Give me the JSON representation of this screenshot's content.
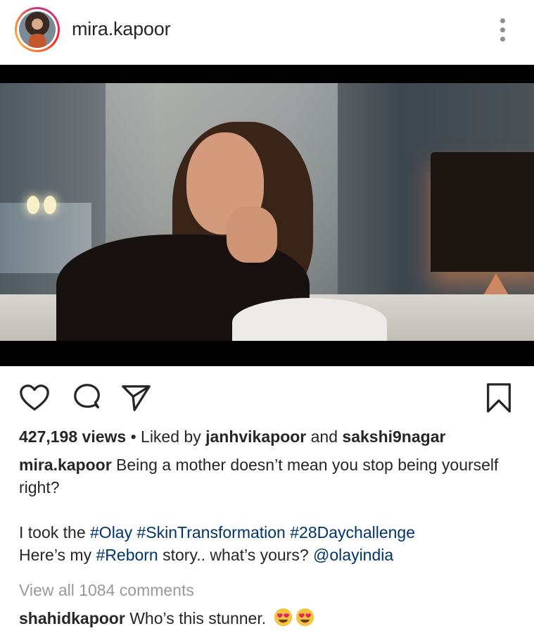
{
  "header": {
    "username": "mira.kapoor",
    "avatar": "profile-photo",
    "more_icon": "more-vertical-icon"
  },
  "media": {
    "type": "video-still",
    "description_icon": "video-frame"
  },
  "actions": {
    "like_icon": "heart-icon",
    "comment_icon": "comment-icon",
    "share_icon": "send-icon",
    "save_icon": "bookmark-icon"
  },
  "stats": {
    "views": "427,198 views",
    "separator": " • ",
    "liked_by_prefix": "Liked by ",
    "liked_by_user1": "janhvikapoor",
    "and": " and ",
    "liked_by_user2": "sakshi9nagar"
  },
  "caption": {
    "author": "mira.kapoor",
    "line1": " Being a mother doesn’t mean you stop being yourself right?",
    "line2_prefix": "I took the ",
    "tag1": "#Olay",
    "tag2": "#SkinTransformation",
    "tag3": "#28Daychallenge",
    "line3_prefix": "Here’s my ",
    "tag4": "#Reborn",
    "line3_middle": " story.. what’s yours? ",
    "mention": "@olayindia"
  },
  "comments": {
    "view_all": "View all 1084 comments",
    "first_author": "shahidkapoor",
    "first_text": " Who’s this stunner. ",
    "first_emojis": [
      "heart-eyes-emoji",
      "heart-eyes-emoji"
    ]
  },
  "colors": {
    "text": "#262626",
    "muted": "#999999",
    "hashtag": "#003569",
    "icon": "#262626"
  }
}
